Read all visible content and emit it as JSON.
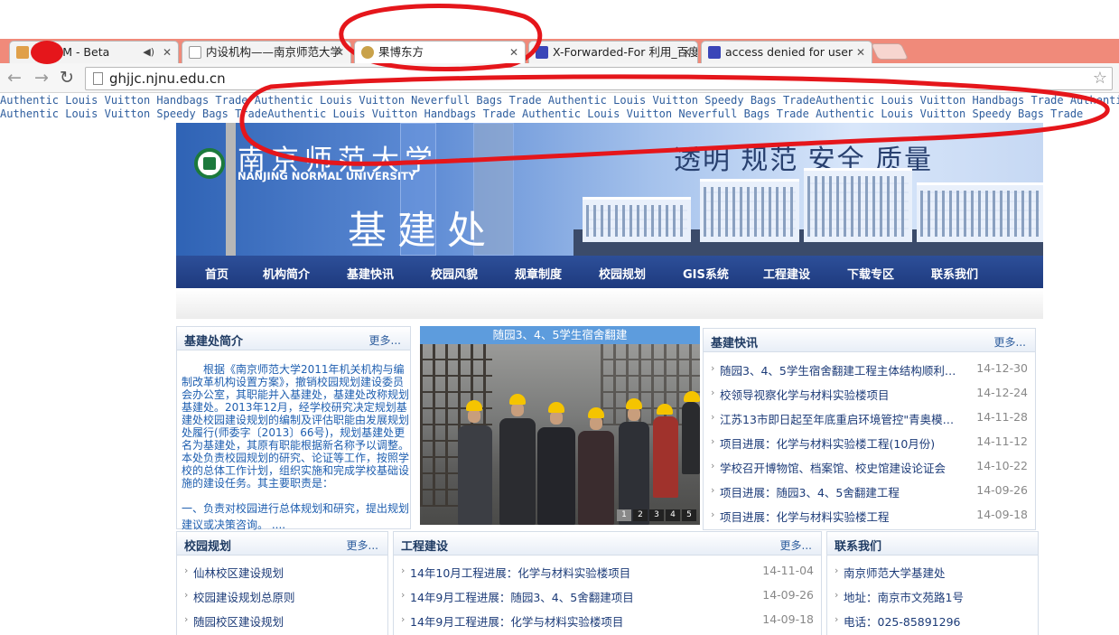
{
  "browser": {
    "tabs": [
      {
        "label": "豆瓣FM - Beta",
        "icon": "douban-icon",
        "has_sound": true
      },
      {
        "label": "内设机构——南京师范大学",
        "icon": "page-icon"
      },
      {
        "label": "果博东方",
        "icon": "casino-icon",
        "active": true
      },
      {
        "label": "X-Forwarded-For 利用_百度",
        "icon": "baidu-paw-icon"
      },
      {
        "label": "access denied for user",
        "icon": "baidu-paw-icon"
      }
    ],
    "url": "ghjjc.njnu.edu.cn"
  },
  "spam_lines": [
    "Authentic Louis Vuitton Handbags Trade Authentic Louis Vuitton Neverfull Bags Trade Authentic Louis Vuitton Speedy Bags TradeAuthentic Louis Vuitton Handbags Trade Authentic Louis Vuitton Neverfull Bags Trade Authentic Louis Vuitton Speedy Bags Trade",
    "Authentic Louis Vuitton Speedy Bags TradeAuthentic Louis Vuitton Handbags Trade Authentic Louis Vuitton Neverfull Bags Trade Authentic Louis Vuitton Speedy Bags Trade"
  ],
  "banner": {
    "university_cn": "南京师范大学",
    "university_en": "NANJING NORMAL UNIVERSITY",
    "department": "基建处",
    "slogan": "透明 规范 安全 质量"
  },
  "nav": [
    "首页",
    "机构简介",
    "基建快讯",
    "校园风貌",
    "规章制度",
    "校园规划",
    "GIS系统",
    "工程建设",
    "下载专区",
    "联系我们"
  ],
  "intro_panel": {
    "title": "基建处简介",
    "more": "更多...",
    "text": "根据《南京师范大学2011年机关机构与编制改革机构设置方案》，撤销校园规划建设委员会办公室，其职能并入基建处，基建处改称规划基建处。2013年12月，经学校研究决定规划基建处校园建设规划的编制及评估职能由发展规划处履行(师委字〔2013〕66号)，规划基建处更名为基建处，其原有职能根据新名称予以调整。本处负责校园规划的研究、论证等工作，按照学校的总体工作计划，组织实施和完成学校基础设施的建设任务。其主要职责是：",
    "text2": "一、负责对校园进行总体规划和研究，提出规划建议或决策咨询。 ...."
  },
  "slider": {
    "caption": "随园3、4、5学生宿舍翻建",
    "pages": [
      "1",
      "2",
      "3",
      "4",
      "5"
    ]
  },
  "news_panel": {
    "title": "基建快讯",
    "more": "更多...",
    "items": [
      {
        "title": "随园3、4、5学生宿舍翻建工程主体结构顺利封顶...",
        "date": "14-12-30"
      },
      {
        "title": "校领导视察化学与材料实验楼项目",
        "date": "14-12-24"
      },
      {
        "title": "江苏13市即日起至年底重启环境管控\"青奥模式...",
        "date": "14-11-28"
      },
      {
        "title": "项目进展：化学与材料实验楼工程(10月份)",
        "date": "14-11-12"
      },
      {
        "title": "学校召开博物馆、档案馆、校史馆建设论证会",
        "date": "14-10-22"
      },
      {
        "title": "项目进展：随园3、4、5舍翻建工程",
        "date": "14-09-26"
      },
      {
        "title": "项目进展：化学与材料实验楼工程",
        "date": "14-09-18"
      }
    ]
  },
  "planning_panel": {
    "title": "校园规划",
    "more": "更多...",
    "items": [
      "仙林校区建设规划",
      "校园建设规划总原则",
      "随园校区建设规划"
    ]
  },
  "project_panel": {
    "title": "工程建设",
    "more": "更多...",
    "items": [
      {
        "title": "14年10月工程进展：化学与材料实验楼项目",
        "date": "14-11-04"
      },
      {
        "title": "14年9月工程进展：随园3、4、5舍翻建项目",
        "date": "14-09-26"
      },
      {
        "title": "14年9月工程进展：化学与材料实验楼项目",
        "date": "14-09-18"
      }
    ]
  },
  "contact_panel": {
    "title": "联系我们",
    "items": [
      "南京师范大学基建处",
      "地址：南京市文苑路1号",
      "电话：025-85891296"
    ]
  },
  "colors": {
    "annotation": "#e5161b",
    "nav_bg": "#244488",
    "link": "#1c3b78"
  }
}
